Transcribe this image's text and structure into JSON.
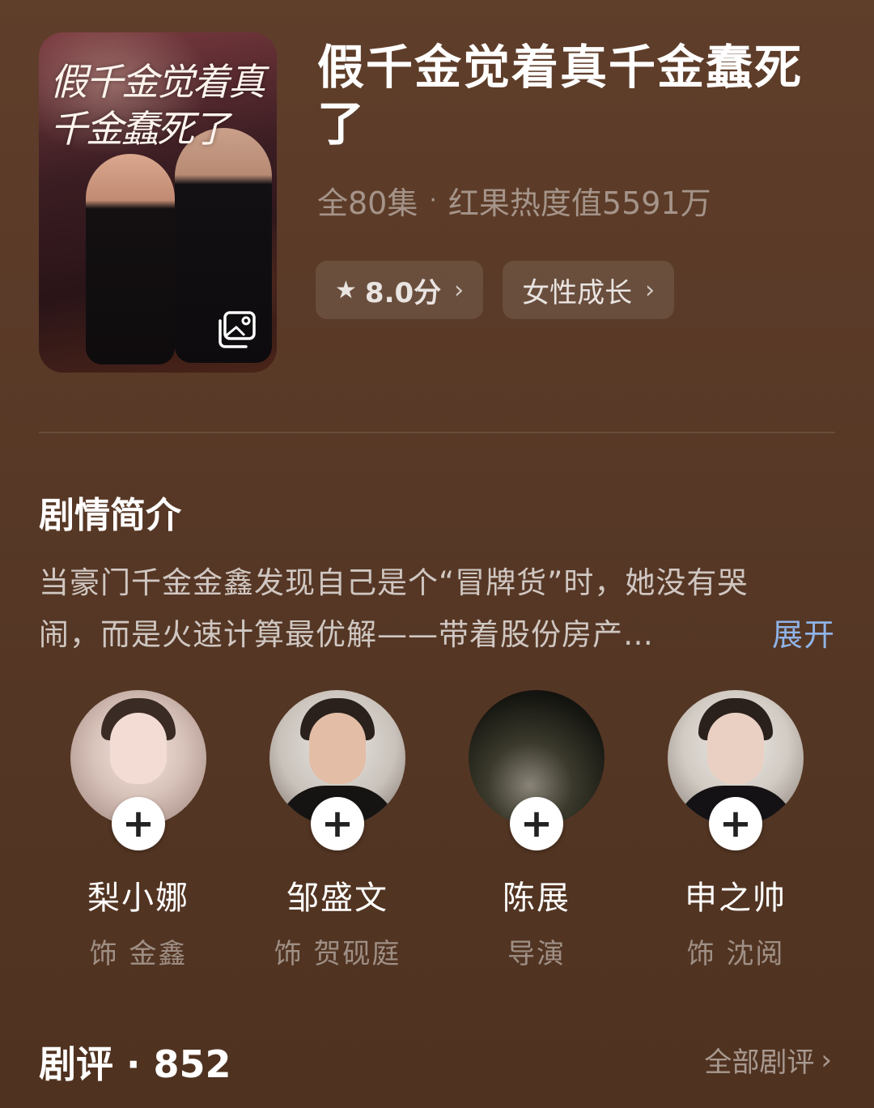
{
  "drama": {
    "poster_title": "假千金觉着真千金蠢死了",
    "title": "假千金觉着真千金蠢死了",
    "episodes": "全80集",
    "heat": "红果热度值5591万",
    "rating": "8.0分",
    "genre": "女性成长"
  },
  "synopsis": {
    "heading": "剧情简介",
    "line1": "当豪门千金金鑫发现自己是个“冒牌货”时，她没有哭",
    "line2": "闹，而是火速计算最优解——带着股份房产…",
    "expand_label": "展开"
  },
  "cast": [
    {
      "name": "梨小娜",
      "role": "饰 金鑫"
    },
    {
      "name": "邹盛文",
      "role": "饰 贺砚庭"
    },
    {
      "name": "陈展",
      "role": "导演"
    },
    {
      "name": "申之帅",
      "role": "饰 沈阅"
    }
  ],
  "reviews": {
    "label": "剧评",
    "count": "852",
    "all_label": "全部剧评"
  },
  "icons": {
    "rating": "star-icon",
    "chevron": "chevron-right-icon",
    "gallery": "gallery-icon",
    "follow": "plus-icon"
  },
  "colors": {
    "background": "#5a3a27",
    "link": "#8fb3e8"
  }
}
